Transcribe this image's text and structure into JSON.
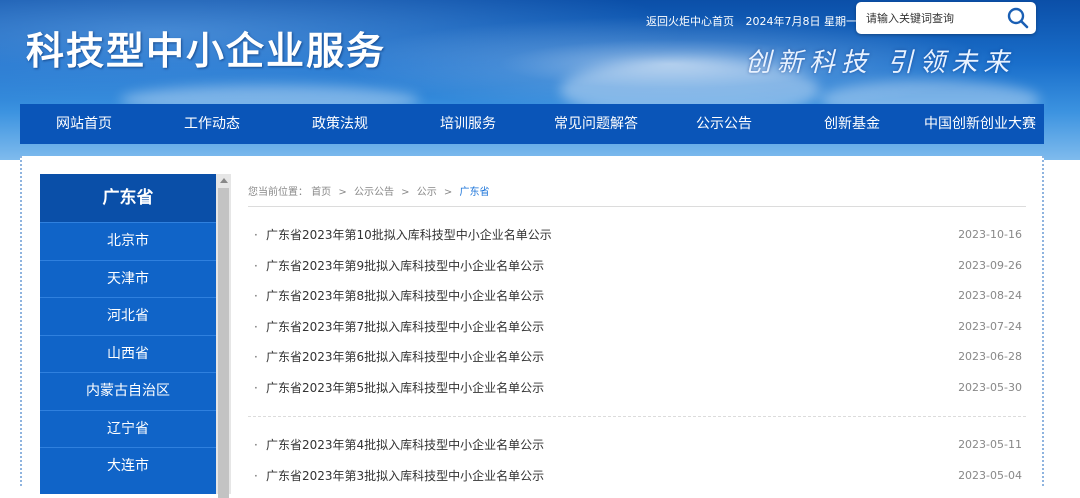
{
  "header": {
    "site_title": "科技型中小企业服务",
    "slogan": "创新科技  引领未来",
    "top_links": {
      "home_link": "返回火炬中心首页",
      "date_text": "2024年7月8日 星期一"
    },
    "search": {
      "placeholder": "请输入关键词查询",
      "icon": "search-icon"
    }
  },
  "nav": {
    "items": [
      {
        "label": "网站首页"
      },
      {
        "label": "工作动态"
      },
      {
        "label": "政策法规"
      },
      {
        "label": "培训服务"
      },
      {
        "label": "常见问题解答"
      },
      {
        "label": "公示公告"
      },
      {
        "label": "创新基金"
      },
      {
        "label": "中国创新创业大赛"
      }
    ]
  },
  "sidebar": {
    "title": "广东省",
    "items": [
      {
        "label": "北京市"
      },
      {
        "label": "天津市"
      },
      {
        "label": "河北省"
      },
      {
        "label": "山西省"
      },
      {
        "label": "内蒙古自治区"
      },
      {
        "label": "辽宁省"
      },
      {
        "label": "大连市"
      }
    ]
  },
  "breadcrumb": {
    "prefix": "您当前位置：",
    "crumbs": [
      "首页",
      "公示公告",
      "公示"
    ],
    "current": "广东省"
  },
  "news": {
    "group1": [
      {
        "title": "广东省2023年第10批拟入库科技型中小企业名单公示",
        "date": "2023-10-16"
      },
      {
        "title": "广东省2023年第9批拟入库科技型中小企业名单公示",
        "date": "2023-09-26"
      },
      {
        "title": "广东省2023年第8批拟入库科技型中小企业名单公示",
        "date": "2023-08-24"
      },
      {
        "title": "广东省2023年第7批拟入库科技型中小企业名单公示",
        "date": "2023-07-24"
      },
      {
        "title": "广东省2023年第6批拟入库科技型中小企业名单公示",
        "date": "2023-06-28"
      },
      {
        "title": "广东省2023年第5批拟入库科技型中小企业名单公示",
        "date": "2023-05-30"
      }
    ],
    "group2": [
      {
        "title": "广东省2023年第4批拟入库科技型中小企业名单公示",
        "date": "2023-05-11"
      },
      {
        "title": "广东省2023年第3批拟入库科技型中小企业名单公示",
        "date": "2023-05-04"
      }
    ]
  },
  "colors": {
    "nav_bg": "#0a55b8",
    "sidebar_bg": "#1064c8",
    "accent": "#1a73d9"
  }
}
